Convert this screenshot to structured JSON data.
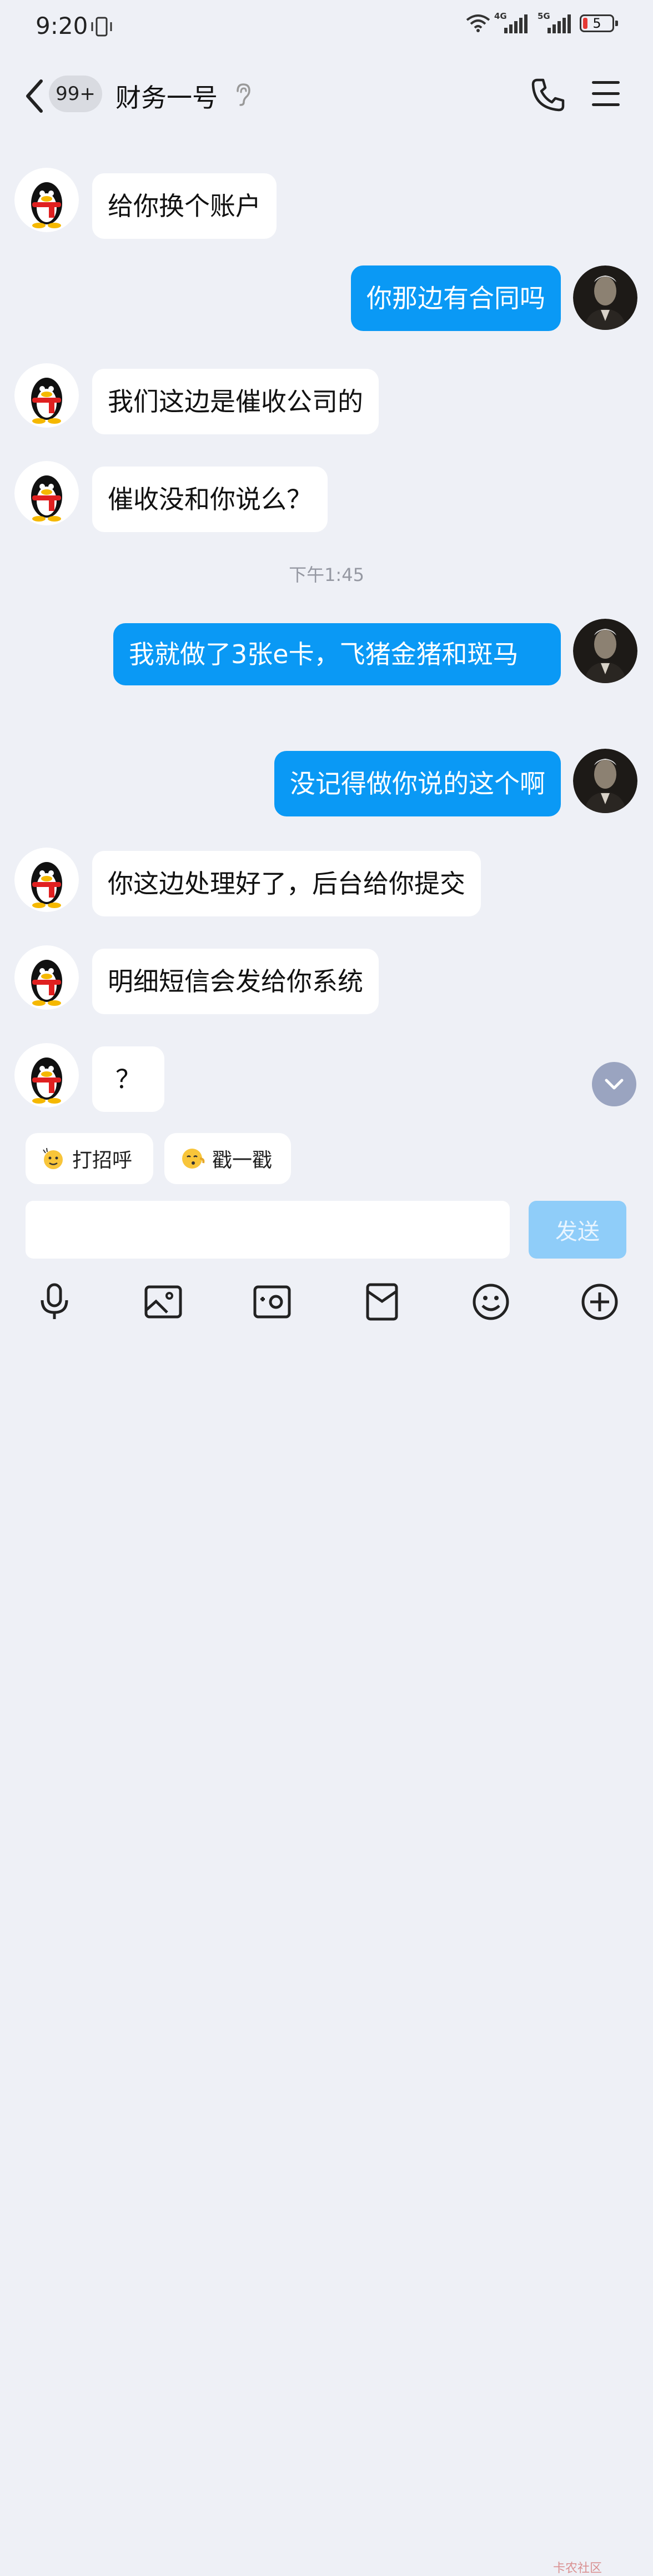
{
  "status": {
    "time": "9:20",
    "net1": "4G",
    "net2": "5G",
    "battery": "5"
  },
  "header": {
    "title": "财务一号",
    "unread_badge": "99+"
  },
  "messages": [
    {
      "side": "in",
      "text": "给你换个账户"
    },
    {
      "side": "out",
      "text": "你那边有合同吗"
    },
    {
      "side": "in",
      "text": "我们这边是催收公司的"
    },
    {
      "side": "in",
      "text": "催收没和你说么？"
    },
    {
      "side": "out",
      "text": "我就做了3张e卡，飞猪金猪和斑马"
    },
    {
      "side": "out",
      "text": "没记得做你说的这个啊"
    },
    {
      "side": "in",
      "text": "你这边处理好了，后台给你提交"
    },
    {
      "side": "in",
      "text": "明细短信会发给你系统"
    },
    {
      "side": "in",
      "text": "？"
    }
  ],
  "timestamp": "下午1:45",
  "quick_replies": [
    {
      "label": "打招呼",
      "icon": "wave-emoji-icon"
    },
    {
      "label": "戳一戳",
      "icon": "poke-emoji-icon"
    }
  ],
  "input": {
    "value": "",
    "placeholder": ""
  },
  "send_label": "发送",
  "toolbar_icons": [
    "microphone-icon",
    "image-icon",
    "camera-icon",
    "red-packet-icon",
    "emoji-icon",
    "plus-icon"
  ],
  "watermark": "卡农社区",
  "colors": {
    "outgoing_bubble": "#0a99f5",
    "send_button": "#8fcdf9",
    "background": "#eef0f6"
  }
}
